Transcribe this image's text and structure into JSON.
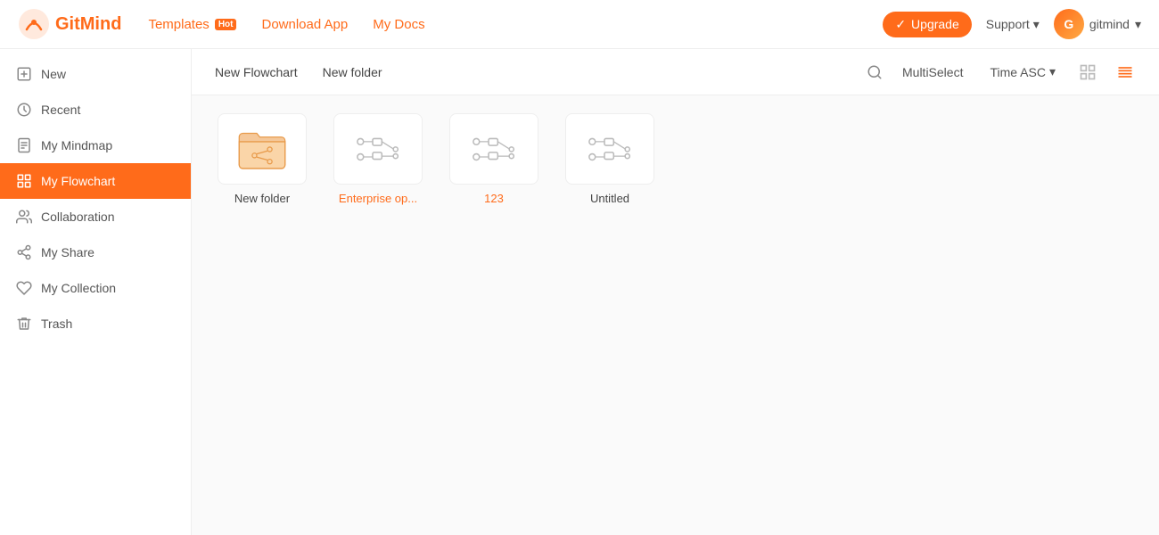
{
  "header": {
    "logo_text": "GitMind",
    "nav": [
      {
        "label": "Templates",
        "badge": "Hot",
        "id": "templates"
      },
      {
        "label": "Download App",
        "id": "download"
      },
      {
        "label": "My Docs",
        "id": "mydocs"
      }
    ],
    "upgrade_label": "Upgrade",
    "support_label": "Support",
    "user_label": "gitmind"
  },
  "sidebar": {
    "items": [
      {
        "id": "new",
        "label": "New",
        "icon": "plus-square"
      },
      {
        "id": "recent",
        "label": "Recent",
        "icon": "clock"
      },
      {
        "id": "mindmap",
        "label": "My Mindmap",
        "icon": "file-text"
      },
      {
        "id": "flowchart",
        "label": "My Flowchart",
        "icon": "grid",
        "active": true
      },
      {
        "id": "collaboration",
        "label": "Collaboration",
        "icon": "users"
      },
      {
        "id": "myshare",
        "label": "My Share",
        "icon": "share"
      },
      {
        "id": "collection",
        "label": "My Collection",
        "icon": "heart"
      },
      {
        "id": "trash",
        "label": "Trash",
        "icon": "trash"
      }
    ]
  },
  "toolbar": {
    "new_flowchart": "New Flowchart",
    "new_folder": "New folder",
    "multiselect": "MultiSelect",
    "sort_label": "Time ASC"
  },
  "content": {
    "items": [
      {
        "id": "folder1",
        "type": "folder",
        "name": "New folder"
      },
      {
        "id": "file1",
        "type": "flowchart",
        "name": "Enterprise op...",
        "name_color": "orange"
      },
      {
        "id": "file2",
        "type": "flowchart",
        "name": "123",
        "name_color": "orange"
      },
      {
        "id": "file3",
        "type": "flowchart",
        "name": "Untitled",
        "name_color": "normal"
      }
    ]
  },
  "colors": {
    "orange": "#ff6b1a",
    "sidebar_active_bg": "#ff6b1a",
    "text_muted": "#888"
  }
}
